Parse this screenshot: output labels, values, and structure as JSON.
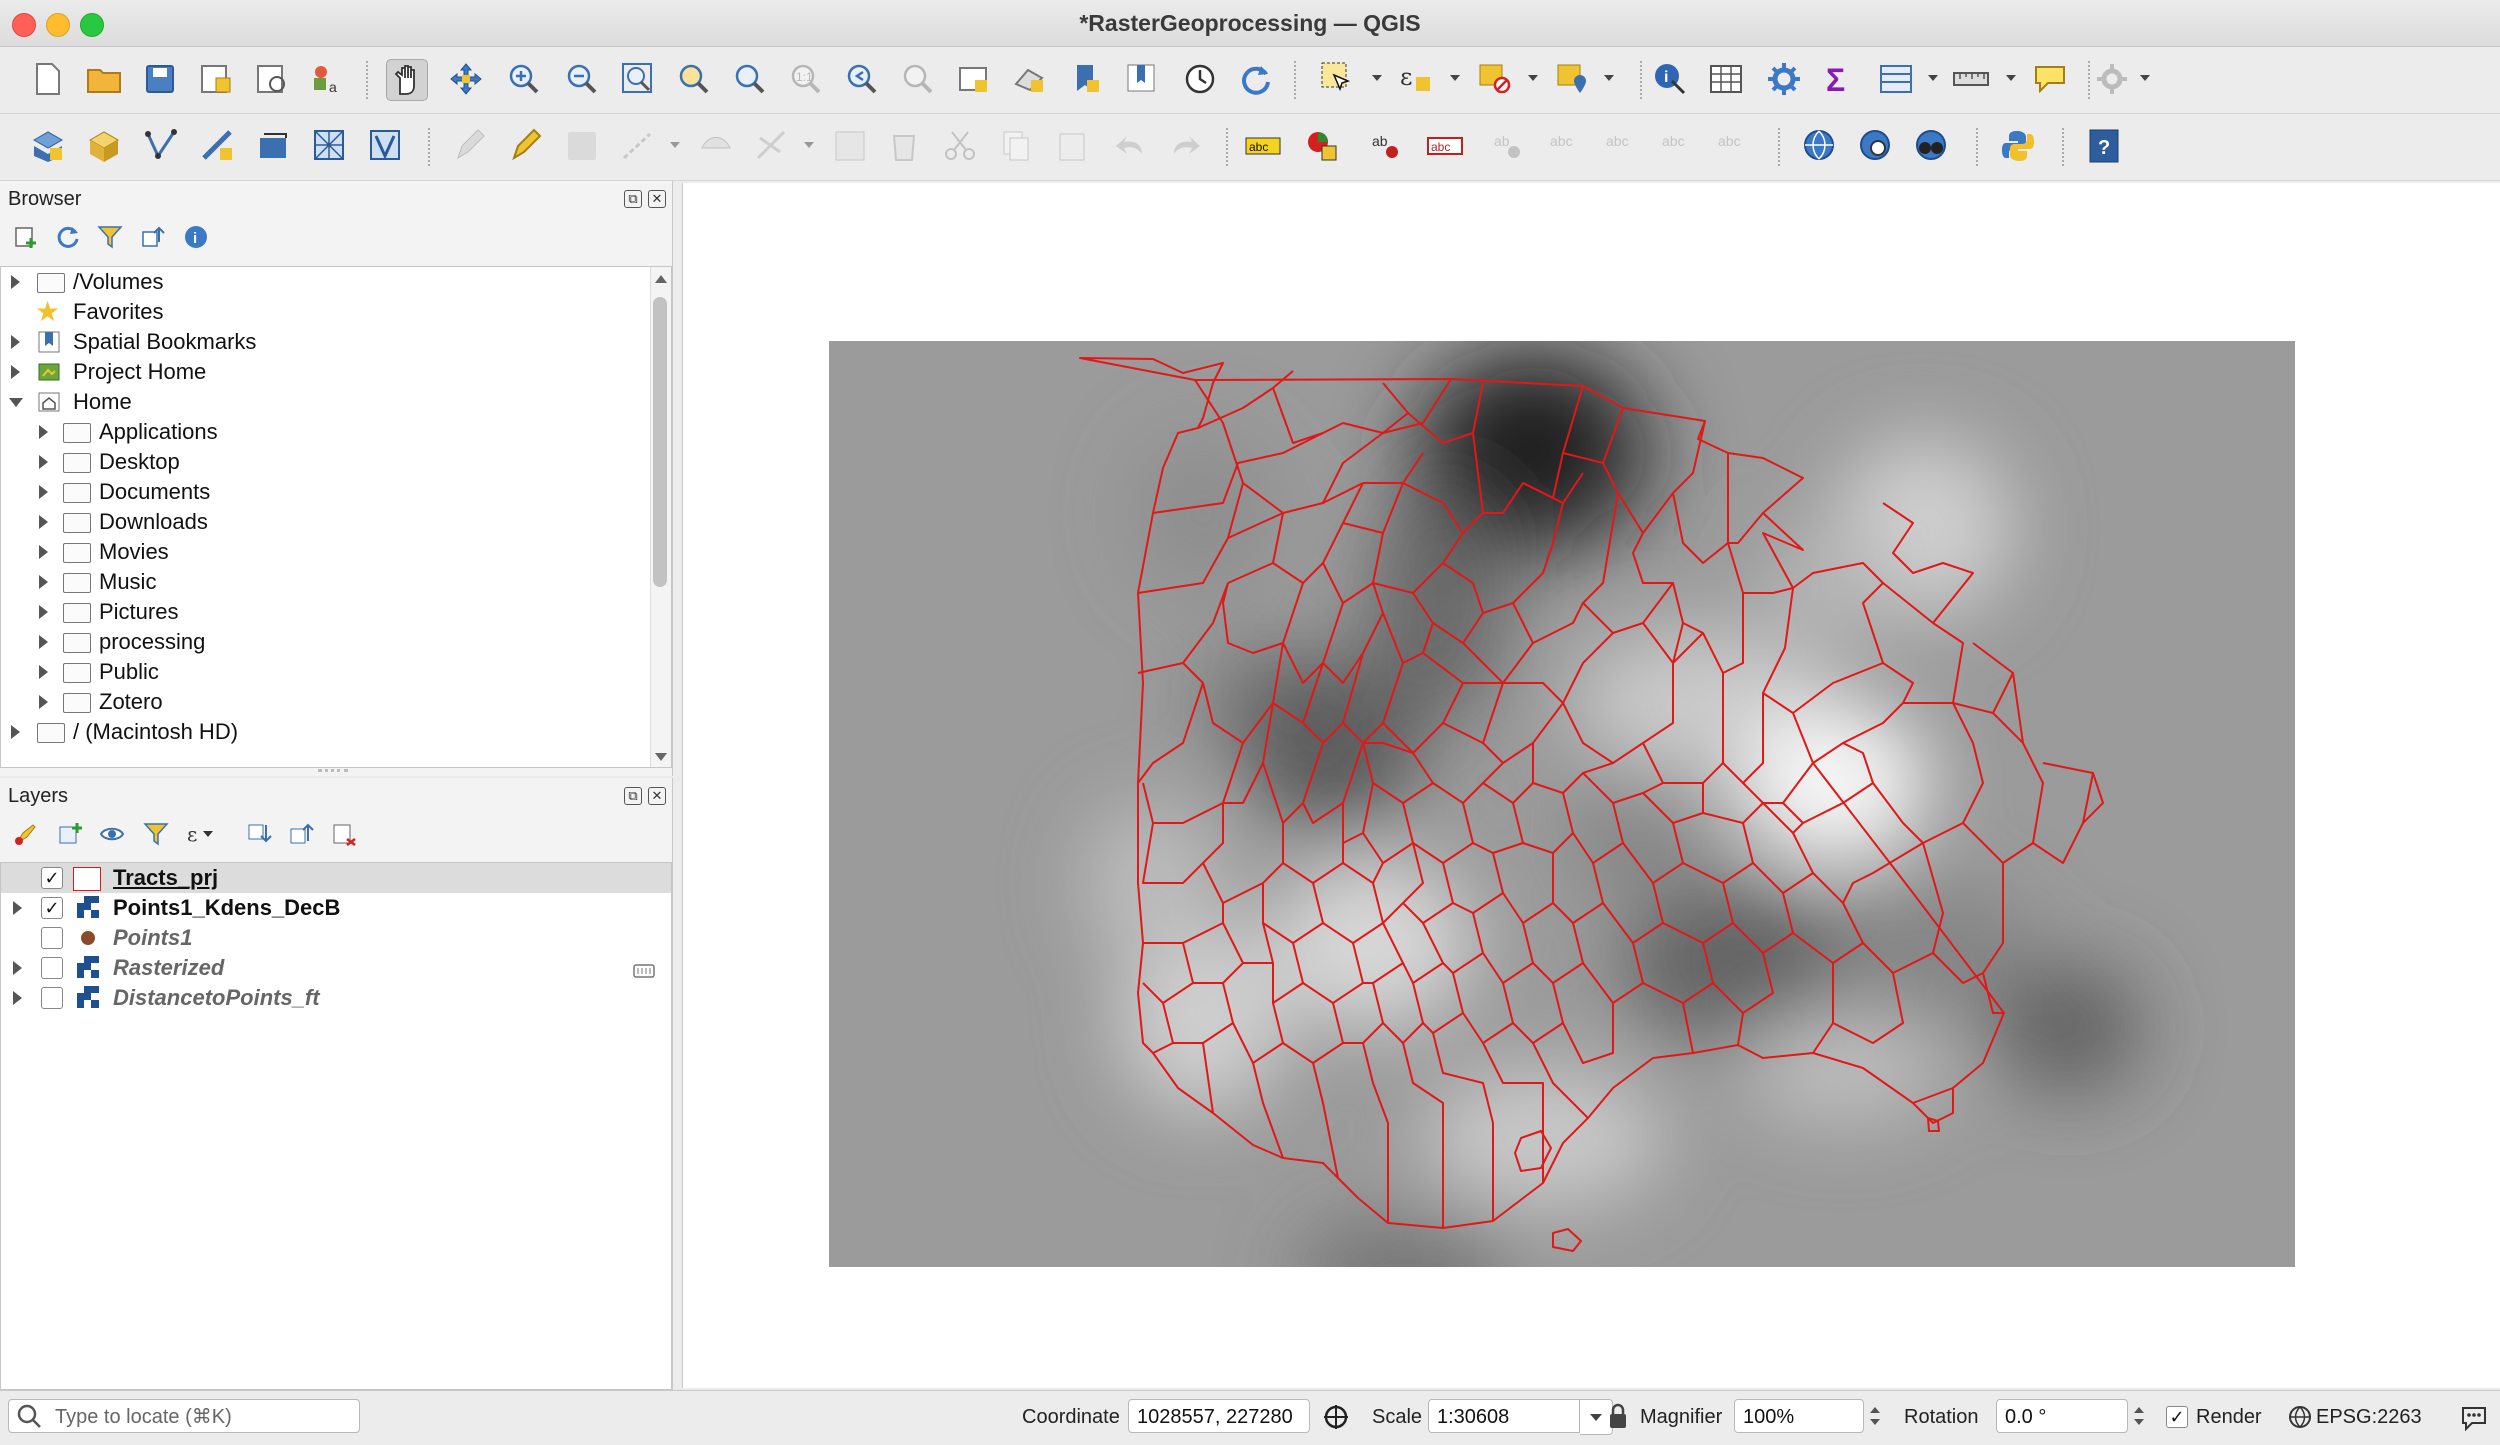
{
  "window": {
    "title": "*RasterGeoprocessing — QGIS"
  },
  "browser": {
    "title": "Browser",
    "items": [
      {
        "label": "/Volumes",
        "icon": "folder-icon",
        "expanded": false
      },
      {
        "label": "Favorites",
        "icon": "star-icon"
      },
      {
        "label": "Spatial Bookmarks",
        "icon": "bookmark-icon",
        "expanded": false
      },
      {
        "label": "Project Home",
        "icon": "project-home-icon",
        "expanded": false
      },
      {
        "label": "Home",
        "icon": "home-icon",
        "expanded": true
      },
      {
        "label": "Applications",
        "icon": "folder-icon"
      },
      {
        "label": "Desktop",
        "icon": "folder-icon"
      },
      {
        "label": "Documents",
        "icon": "folder-icon"
      },
      {
        "label": "Downloads",
        "icon": "folder-icon"
      },
      {
        "label": "Movies",
        "icon": "folder-icon"
      },
      {
        "label": "Music",
        "icon": "folder-icon"
      },
      {
        "label": "Pictures",
        "icon": "folder-icon"
      },
      {
        "label": "processing",
        "icon": "folder-icon"
      },
      {
        "label": "Public",
        "icon": "folder-icon"
      },
      {
        "label": "Zotero",
        "icon": "folder-icon"
      },
      {
        "label": "/ (Macintosh HD)",
        "icon": "folder-icon",
        "expanded": false
      }
    ]
  },
  "layers": {
    "title": "Layers",
    "items": [
      {
        "label": "Tracts_prj",
        "checked": true,
        "icon": "polygon-layer-icon",
        "selected": true
      },
      {
        "label": "Points1_Kdens_DecB",
        "checked": true,
        "icon": "raster-layer-icon"
      },
      {
        "label": "Points1",
        "checked": false,
        "icon": "point-layer-icon"
      },
      {
        "label": "Rasterized",
        "checked": false,
        "icon": "raster-layer-icon"
      },
      {
        "label": "DistancetoPoints_ft",
        "checked": false,
        "icon": "raster-layer-icon"
      }
    ]
  },
  "status": {
    "locate_placeholder": "Type to locate (⌘K)",
    "coordinate_label": "Coordinate",
    "coordinate_value": "1028557, 227280",
    "scale_label": "Scale",
    "scale_value": "1:30608",
    "magnifier_label": "Magnifier",
    "magnifier_value": "100%",
    "rotation_label": "Rotation",
    "rotation_value": "0.0 °",
    "render_label": "Render",
    "render_checked": true,
    "crs": "EPSG:2263"
  },
  "colors": {
    "accent": "#e01818",
    "raster_bg": "#9b9b9b",
    "panel": "#f3f3f3"
  }
}
